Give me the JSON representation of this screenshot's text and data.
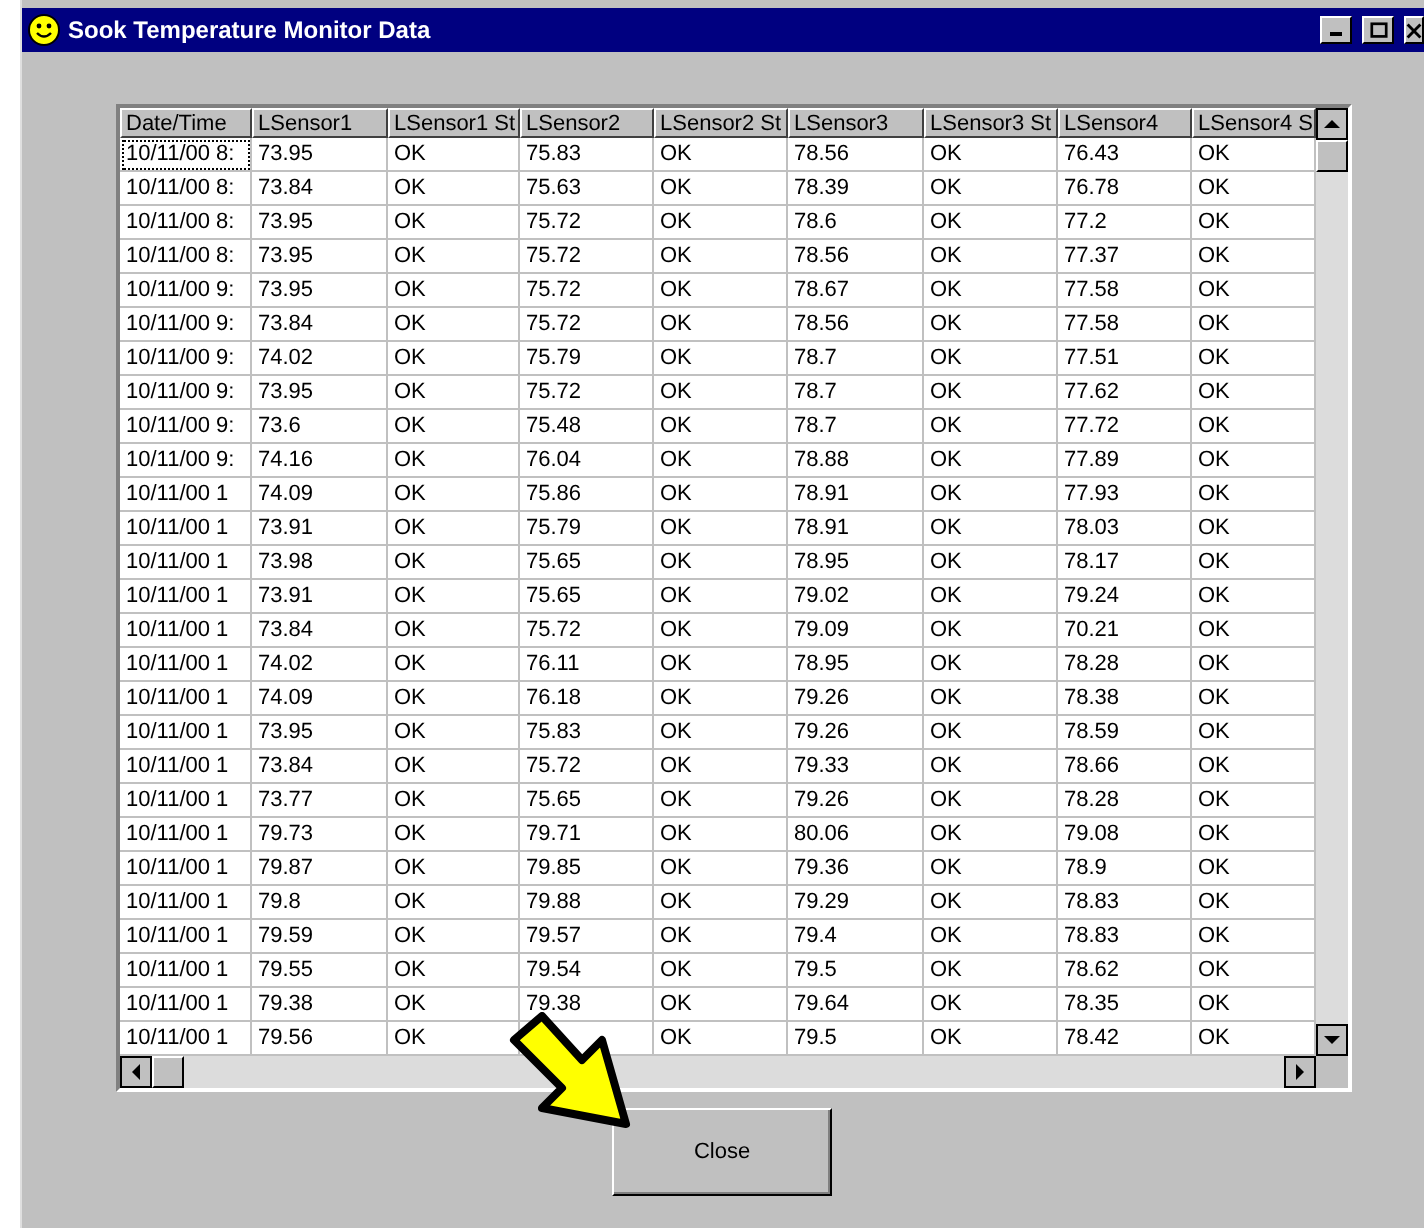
{
  "window": {
    "title": "Sook Temperature Monitor Data"
  },
  "table": {
    "columns": [
      "Date/Time",
      "LSensor1",
      "LSensor1 St",
      "LSensor2",
      "LSensor2 St",
      "LSensor3",
      "LSensor3 St",
      "LSensor4",
      "LSensor4 S"
    ],
    "rows": [
      [
        "10/11/00 8:",
        "73.95",
        "OK",
        "75.83",
        "OK",
        "78.56",
        "OK",
        "76.43",
        "OK"
      ],
      [
        "10/11/00 8:",
        "73.84",
        "OK",
        "75.63",
        "OK",
        "78.39",
        "OK",
        "76.78",
        "OK"
      ],
      [
        "10/11/00 8:",
        "73.95",
        "OK",
        "75.72",
        "OK",
        "78.6",
        "OK",
        "77.2",
        "OK"
      ],
      [
        "10/11/00 8:",
        "73.95",
        "OK",
        "75.72",
        "OK",
        "78.56",
        "OK",
        "77.37",
        "OK"
      ],
      [
        "10/11/00 9:",
        "73.95",
        "OK",
        "75.72",
        "OK",
        "78.67",
        "OK",
        "77.58",
        "OK"
      ],
      [
        "10/11/00 9:",
        "73.84",
        "OK",
        "75.72",
        "OK",
        "78.56",
        "OK",
        "77.58",
        "OK"
      ],
      [
        "10/11/00 9:",
        "74.02",
        "OK",
        "75.79",
        "OK",
        "78.7",
        "OK",
        "77.51",
        "OK"
      ],
      [
        "10/11/00 9:",
        "73.95",
        "OK",
        "75.72",
        "OK",
        "78.7",
        "OK",
        "77.62",
        "OK"
      ],
      [
        "10/11/00 9:",
        "73.6",
        "OK",
        "75.48",
        "OK",
        "78.7",
        "OK",
        "77.72",
        "OK"
      ],
      [
        "10/11/00 9:",
        "74.16",
        "OK",
        "76.04",
        "OK",
        "78.88",
        "OK",
        "77.89",
        "OK"
      ],
      [
        "10/11/00 1",
        "74.09",
        "OK",
        "75.86",
        "OK",
        "78.91",
        "OK",
        "77.93",
        "OK"
      ],
      [
        "10/11/00 1",
        "73.91",
        "OK",
        "75.79",
        "OK",
        "78.91",
        "OK",
        "78.03",
        "OK"
      ],
      [
        "10/11/00 1",
        "73.98",
        "OK",
        "75.65",
        "OK",
        "78.95",
        "OK",
        "78.17",
        "OK"
      ],
      [
        "10/11/00 1",
        "73.91",
        "OK",
        "75.65",
        "OK",
        "79.02",
        "OK",
        "79.24",
        "OK"
      ],
      [
        "10/11/00 1",
        "73.84",
        "OK",
        "75.72",
        "OK",
        "79.09",
        "OK",
        "70.21",
        "OK"
      ],
      [
        "10/11/00 1",
        "74.02",
        "OK",
        "76.11",
        "OK",
        "78.95",
        "OK",
        "78.28",
        "OK"
      ],
      [
        "10/11/00 1",
        "74.09",
        "OK",
        "76.18",
        "OK",
        "79.26",
        "OK",
        "78.38",
        "OK"
      ],
      [
        "10/11/00 1",
        "73.95",
        "OK",
        "75.83",
        "OK",
        "79.26",
        "OK",
        "78.59",
        "OK"
      ],
      [
        "10/11/00 1",
        "73.84",
        "OK",
        "75.72",
        "OK",
        "79.33",
        "OK",
        "78.66",
        "OK"
      ],
      [
        "10/11/00 1",
        "73.77",
        "OK",
        "75.65",
        "OK",
        "79.26",
        "OK",
        "78.28",
        "OK"
      ],
      [
        "10/11/00 1",
        "79.73",
        "OK",
        "79.71",
        "OK",
        "80.06",
        "OK",
        "79.08",
        "OK"
      ],
      [
        "10/11/00 1",
        "79.87",
        "OK",
        "79.85",
        "OK",
        "79.36",
        "OK",
        "78.9",
        "OK"
      ],
      [
        "10/11/00 1",
        "79.8",
        "OK",
        "79.88",
        "OK",
        "79.29",
        "OK",
        "78.83",
        "OK"
      ],
      [
        "10/11/00 1",
        "79.59",
        "OK",
        "79.57",
        "OK",
        "79.4",
        "OK",
        "78.83",
        "OK"
      ],
      [
        "10/11/00 1",
        "79.55",
        "OK",
        "79.54",
        "OK",
        "79.5",
        "OK",
        "78.62",
        "OK"
      ],
      [
        "10/11/00 1",
        "79.38",
        "OK",
        "79.38",
        "OK",
        "79.64",
        "OK",
        "78.35",
        "OK"
      ],
      [
        "10/11/00 1",
        "79.56",
        "OK",
        null,
        "OK",
        "79.5",
        "OK",
        "78.42",
        "OK"
      ]
    ]
  },
  "buttons": [
    "Close"
  ]
}
